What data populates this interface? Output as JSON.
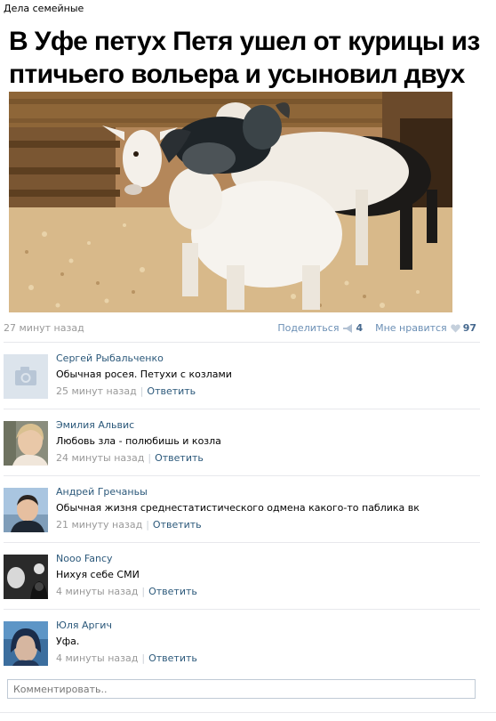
{
  "group": {
    "name": "Дела семейные"
  },
  "post": {
    "title": "В Уфе петух Петя ушел от курицы из птичьего вольера и усыновил двух козлят",
    "time": "27 минут назад",
    "share_label": "Поделиться",
    "share_count": "4",
    "like_label": "Мне нравится",
    "like_count": "97",
    "accent_color": "#45688e"
  },
  "comments": [
    {
      "author": "Сергей Рыбальченко",
      "text": "Обычная росея. Петухи с козлами",
      "time": "25 минут назад",
      "reply": "Ответить",
      "avatar": "camera-placeholder-icon"
    },
    {
      "author": "Эмилия Альвис",
      "text": "Любовь зла - полюбишь и козла",
      "time": "24 минуты назад",
      "reply": "Ответить",
      "avatar": "user-photo"
    },
    {
      "author": "Андрей Гречаньы",
      "text": "Обычная жизня среднестатистического одмена какого-то паблика вк",
      "time": "21 минуту назад",
      "reply": "Ответить",
      "avatar": "user-photo"
    },
    {
      "author": "Nooo Fancy",
      "text": "Нихуя себе СМИ",
      "time": "4 минуты назад",
      "reply": "Ответить",
      "avatar": "user-photo"
    },
    {
      "author": "Юля Аргич",
      "text": "Уфа.",
      "time": "4 минуты назад",
      "reply": "Ответить",
      "avatar": "user-photo"
    }
  ],
  "composer": {
    "placeholder": "Комментировать.."
  }
}
